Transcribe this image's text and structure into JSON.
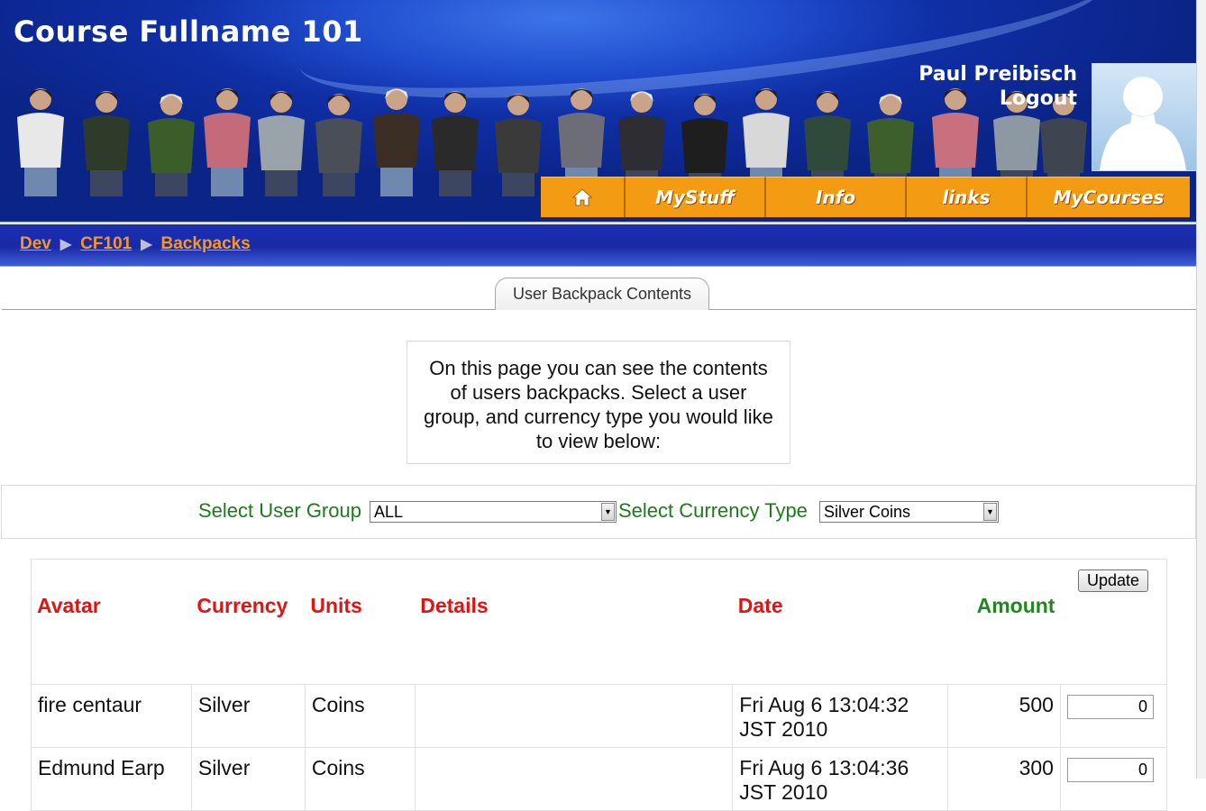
{
  "header": {
    "course_title": "Course Fullname 101",
    "user_name": "Paul Preibisch",
    "logout": "Logout",
    "nav": [
      {
        "label": "",
        "icon": "home-icon"
      },
      {
        "label": "MyStuff"
      },
      {
        "label": "Info"
      },
      {
        "label": "links"
      },
      {
        "label": "MyCourses"
      }
    ]
  },
  "breadcrumb": [
    "Dev",
    "CF101",
    "Backpacks"
  ],
  "tab": {
    "label": "User Backpack Contents"
  },
  "info_text": "On this page you can see the contents of users backpacks. Select a user group, and currency type you would like to view below:",
  "filters": {
    "group_label": "Select User Group",
    "group_value": "ALL",
    "currency_label": "Select Currency Type",
    "currency_value": "Silver Coins"
  },
  "table": {
    "headers": {
      "avatar": "Avatar",
      "currency": "Currency",
      "units": "Units",
      "details": "Details",
      "date": "Date",
      "amount": "Amount"
    },
    "update_label": "Update",
    "rows": [
      {
        "avatar": "fire centaur",
        "currency": "Silver",
        "units": "Coins",
        "details": "",
        "date": "Fri Aug 6 13:04:32 JST 2010",
        "amount": "500",
        "input": "0"
      },
      {
        "avatar": "Edmund Earp",
        "currency": "Silver",
        "units": "Coins",
        "details": "",
        "date": "Fri Aug 6 13:04:36 JST 2010",
        "amount": "300",
        "input": "0"
      }
    ]
  },
  "colors": {
    "header_blue": "#0f2fa6",
    "nav_orange": "#f39b12",
    "link_orange": "#f3972a",
    "header_red": "#e01414",
    "green": "#1e7a1e"
  }
}
